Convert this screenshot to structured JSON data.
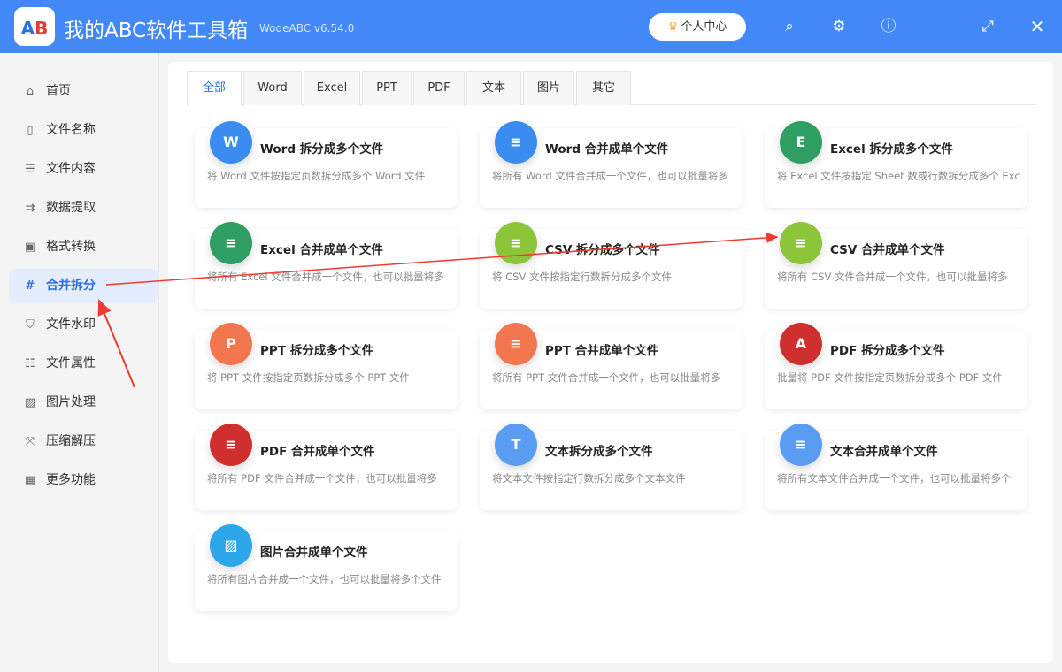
{
  "app": {
    "logo_text": "AB",
    "title": "我的ABC软件工具箱",
    "version": "WodeABC v6.54.0",
    "user_center": "个人中心"
  },
  "sidebar": {
    "items": [
      {
        "label": "首页",
        "icon": "home-icon",
        "glyph": "⌂"
      },
      {
        "label": "文件名称",
        "icon": "file-name-icon",
        "glyph": "▯"
      },
      {
        "label": "文件内容",
        "icon": "file-content-icon",
        "glyph": "☰"
      },
      {
        "label": "数据提取",
        "icon": "data-extract-icon",
        "glyph": "⇉"
      },
      {
        "label": "格式转换",
        "icon": "format-convert-icon",
        "glyph": "▣"
      },
      {
        "label": "合并拆分",
        "icon": "merge-split-icon",
        "glyph": "#",
        "active": true
      },
      {
        "label": "文件水印",
        "icon": "watermark-shield-icon",
        "glyph": "⛉"
      },
      {
        "label": "文件属性",
        "icon": "file-properties-icon",
        "glyph": "☷"
      },
      {
        "label": "图片处理",
        "icon": "image-icon",
        "glyph": "▨"
      },
      {
        "label": "压缩解压",
        "icon": "compress-icon",
        "glyph": "⤧"
      },
      {
        "label": "更多功能",
        "icon": "more-icon",
        "glyph": "▦"
      }
    ]
  },
  "tabs": [
    "全部",
    "Word",
    "Excel",
    "PPT",
    "PDF",
    "文本",
    "图片",
    "其它"
  ],
  "cards": [
    {
      "title": "Word 拆分成多个文件",
      "desc": "将 Word 文件按指定页数拆分成多个 Word 文件",
      "glyph": "W",
      "color": "#3b8cf0"
    },
    {
      "title": "Word 合并成单个文件",
      "desc": "将所有 Word 文件合并成一个文件，也可以批量将多",
      "glyph": "≡",
      "color": "#3b8cf0"
    },
    {
      "title": "Excel 拆分成多个文件",
      "desc": "将 Excel 文件按指定 Sheet 数或行数拆分成多个 Exc",
      "glyph": "E",
      "color": "#2e9e63"
    },
    {
      "title": "Excel 合并成单个文件",
      "desc": "将所有 Excel 文件合并成一个文件，也可以批量将多",
      "glyph": "≡",
      "color": "#2e9e63"
    },
    {
      "title": "CSV 拆分成多个文件",
      "desc": "将 CSV 文件按指定行数拆分成多个文件",
      "glyph": "≡",
      "color": "#8cc43a"
    },
    {
      "title": "CSV 合并成单个文件",
      "desc": "将所有 CSV 文件合并成一个文件，也可以批量将多",
      "glyph": "≡",
      "color": "#8cc43a"
    },
    {
      "title": "PPT 拆分成多个文件",
      "desc": "将 PPT 文件按指定页数拆分成多个 PPT 文件",
      "glyph": "P",
      "color": "#f2774e"
    },
    {
      "title": "PPT 合并成单个文件",
      "desc": "将所有 PPT 文件合并成一个文件，也可以批量将多",
      "glyph": "≡",
      "color": "#f2774e"
    },
    {
      "title": "PDF 拆分成多个文件",
      "desc": "批量将 PDF 文件按指定页数拆分成多个 PDF 文件",
      "glyph": "A",
      "color": "#d02f2f"
    },
    {
      "title": "PDF 合并成单个文件",
      "desc": "将所有 PDF 文件合并成一个文件，也可以批量将多",
      "glyph": "≡",
      "color": "#d02f2f"
    },
    {
      "title": "文本拆分成多个文件",
      "desc": "将文本文件按指定行数拆分成多个文本文件",
      "glyph": "T",
      "color": "#5a9cf2"
    },
    {
      "title": "文本合并成单个文件",
      "desc": "将所有文本文件合并成一个文件，也可以批量将多个",
      "glyph": "≡",
      "color": "#5a9cf2"
    },
    {
      "title": "图片合并成单个文件",
      "desc": "将所有图片合并成一个文件，也可以批量将多个文件",
      "glyph": "▨",
      "color": "#2ca8ea"
    }
  ]
}
